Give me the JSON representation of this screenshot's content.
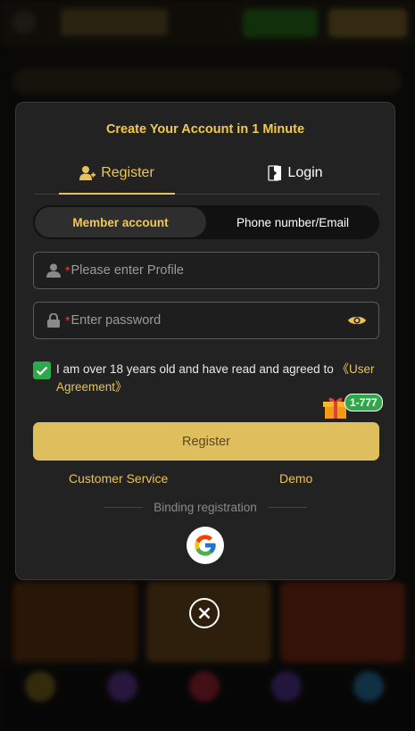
{
  "modal": {
    "title": "Create Your Account in 1 Minute",
    "tabs": [
      {
        "label": "Register",
        "icon": "user-add-icon",
        "active": true
      },
      {
        "label": "Login",
        "icon": "login-door-icon",
        "active": false
      }
    ],
    "account_types": [
      {
        "label": "Member account",
        "selected": true
      },
      {
        "label": "Phone number/Email",
        "selected": false
      }
    ],
    "profile_field": {
      "required_mark": "*",
      "placeholder": "Please enter Profile",
      "value": "",
      "icon": "user-icon"
    },
    "password_field": {
      "required_mark": "*",
      "placeholder": "Enter password",
      "value": "",
      "icon": "lock-icon",
      "toggle_icon": "eye-icon"
    },
    "agreement": {
      "checked": true,
      "text": "I am over 18 years old and have read and agreed to ",
      "link": "《User Agreement》"
    },
    "gift_badge": "1-777",
    "register_button": "Register",
    "customer_service": "Customer Service",
    "demo": "Demo",
    "binding_label": "Binding registration",
    "google_icon": "google-icon"
  },
  "close_icon": "close-icon",
  "colors": {
    "accent": "#f2c94c",
    "button": "#dfbe5e",
    "check": "#2ea84a",
    "modal_bg": "#222222"
  }
}
